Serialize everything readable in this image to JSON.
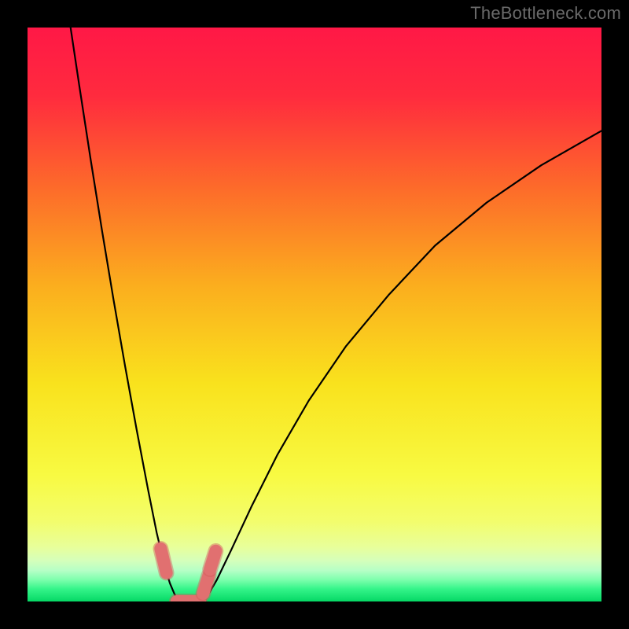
{
  "watermark": "TheBottleneck.com",
  "accent": {
    "marker_fill": "#e17070",
    "marker_stroke": "#d35c5c",
    "curve": "#000000"
  },
  "chart_data": {
    "type": "line",
    "title": "",
    "xlabel": "",
    "ylabel": "",
    "xlim": [
      0,
      100
    ],
    "ylim": [
      0,
      100
    ],
    "gradient_stops": [
      {
        "offset": 0.0,
        "color": "#ff1846"
      },
      {
        "offset": 0.12,
        "color": "#ff2b3e"
      },
      {
        "offset": 0.28,
        "color": "#fd6b2a"
      },
      {
        "offset": 0.45,
        "color": "#fbae1e"
      },
      {
        "offset": 0.62,
        "color": "#f9e21d"
      },
      {
        "offset": 0.78,
        "color": "#f8fa42"
      },
      {
        "offset": 0.86,
        "color": "#f3fd6c"
      },
      {
        "offset": 0.905,
        "color": "#e8ff9a"
      },
      {
        "offset": 0.928,
        "color": "#d6ffba"
      },
      {
        "offset": 0.946,
        "color": "#b6ffc6"
      },
      {
        "offset": 0.962,
        "color": "#7effad"
      },
      {
        "offset": 0.978,
        "color": "#35f58a"
      },
      {
        "offset": 1.0,
        "color": "#05d865"
      }
    ],
    "series": [
      {
        "name": "left-branch",
        "x": [
          7.5,
          9.0,
          11.0,
          13.0,
          15.0,
          17.0,
          19.0,
          21.0,
          22.5,
          23.8,
          24.8,
          25.6,
          26.2,
          26.7
        ],
        "y": [
          100,
          90.0,
          77.0,
          64.5,
          52.5,
          41.0,
          30.0,
          19.5,
          12.0,
          6.5,
          3.2,
          1.3,
          0.3,
          0.0
        ]
      },
      {
        "name": "right-branch",
        "x": [
          30.3,
          31.3,
          33.0,
          35.5,
          39.0,
          43.5,
          49.0,
          55.5,
          63.0,
          71.0,
          80.0,
          89.5,
          100.0
        ],
        "y": [
          0.0,
          0.9,
          3.8,
          9.0,
          16.5,
          25.5,
          35.0,
          44.5,
          53.5,
          62.0,
          69.5,
          76.0,
          82.0
        ]
      }
    ],
    "flat_segment": {
      "x": [
        26.7,
        30.3
      ],
      "y": 0.0
    },
    "markers": [
      {
        "x1": 23.2,
        "y1": 9.2,
        "x2": 24.2,
        "y2": 5.0
      },
      {
        "x1": 26.0,
        "y1": 0.0,
        "x2": 30.0,
        "y2": 0.0
      },
      {
        "x1": 30.6,
        "y1": 1.4,
        "x2": 31.6,
        "y2": 4.6
      },
      {
        "x1": 31.8,
        "y1": 5.6,
        "x2": 32.8,
        "y2": 8.8
      }
    ]
  }
}
